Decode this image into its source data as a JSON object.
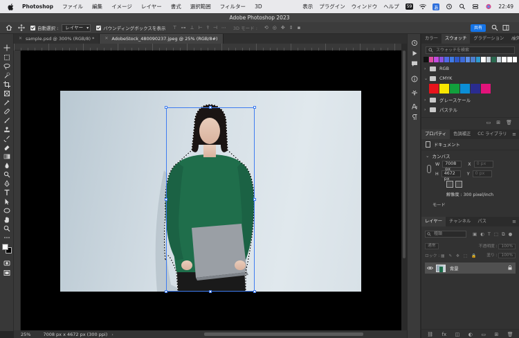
{
  "menubar": {
    "app_name": "Photoshop",
    "items": [
      "ファイル",
      "編集",
      "イメージ",
      "レイヤー",
      "書式",
      "選択範囲",
      "フィルター",
      "3D",
      "表示",
      "プラグイン",
      "ウィンドウ",
      "ヘルプ"
    ],
    "clock": "22:49",
    "input_badge": "あ",
    "battery_badge": "59"
  },
  "window": {
    "title": "Adobe Photoshop 2023"
  },
  "options_bar": {
    "auto_select_label": "自動選択 :",
    "auto_select_value": "レイヤー",
    "show_transform_label": "バウンディングボックスを表示",
    "mode_3d_label": "3D モード :",
    "share_label": "共有"
  },
  "doc_tabs": [
    {
      "label": "sample.psd @ 300% (RGB/8) *",
      "active": false
    },
    {
      "label": "AdobeStock_480090237.jpeg @ 25% (RGB/8#)",
      "active": true
    }
  ],
  "status_bar": {
    "zoom": "25%",
    "info": "7008 px x 4672 px (300 ppi)",
    "arrow": "›"
  },
  "swatches_panel": {
    "tabs": [
      "カラー",
      "スウォッチ",
      "グラデーション",
      "パターン"
    ],
    "active_tab": 1,
    "search_placeholder": "スウォッチを検索",
    "recent_colors": [
      "#111111",
      "#e04ca0",
      "#c24be0",
      "#8a52e0",
      "#4f69e8",
      "#3f7be6",
      "#2f58c8",
      "#3d6bd8",
      "#5b8fe8",
      "#4e7fcf",
      "#2f9bd0",
      "#ffffff",
      "#c8d3da",
      "#2a6a50",
      "#cad4da",
      "#ffffff",
      "#ffffff",
      "#ffffff"
    ],
    "groups": [
      "RGB",
      "CMYK",
      "グレースケール",
      "パステル"
    ],
    "cmyk_colors": [
      "#e8141c",
      "#f7e600",
      "#12a03c",
      "#0b8ed6",
      "#2a2c8f",
      "#e2137a"
    ]
  },
  "properties_panel": {
    "tabs": [
      "プロパティ",
      "色調補正",
      "CC ライブラリ"
    ],
    "active_tab": 0,
    "doc_label": "ドキュメント",
    "canvas_label": "カンバス",
    "w_label": "W",
    "w_value": "7008 px",
    "x_label": "X",
    "x_value": "0 px",
    "h_label": "H",
    "h_value": "4672 px",
    "y_label": "Y",
    "y_value": "0 px",
    "resolution": "解像度 : 300 pixel/inch",
    "mode_label": "モード"
  },
  "layers_panel": {
    "tabs": [
      "レイヤー",
      "チャンネル",
      "パス"
    ],
    "active_tab": 0,
    "search_placeholder": "種類",
    "blend_mode": "通常",
    "opacity_label": "不透明度 :",
    "opacity_value": "100%",
    "lock_label": "ロック :",
    "fill_label": "塗り :",
    "fill_value": "100%",
    "layer_name": "背景"
  },
  "colors": {
    "accent_blue": "#1473e6",
    "transform_blue": "#3d7bf0",
    "sweater_green": "#1f6e4b"
  }
}
